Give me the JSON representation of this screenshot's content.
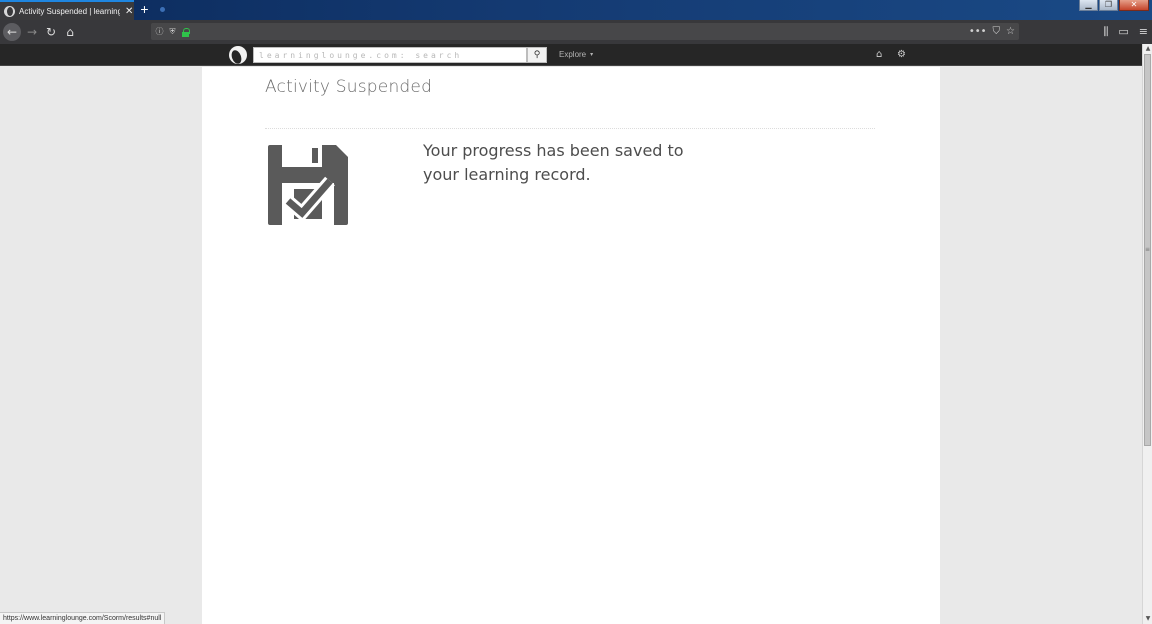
{
  "browser": {
    "tab_title": "Activity Suspended | learninglo",
    "tab_close": "✕",
    "new_tab": "+",
    "window_controls": {
      "minimize": "▁",
      "maximize": "❐",
      "close": "✕"
    },
    "toolbar_icons": {
      "back": "arrow-left-icon",
      "forward": "arrow-right-icon",
      "reload": "reload-icon",
      "home": "home-icon",
      "page_actions": "ellipsis-icon",
      "pocket": "pocket-icon",
      "bookmark": "star-icon",
      "library": "library-icon",
      "sidebar": "sidebar-icon",
      "menu": "hamburger-icon"
    },
    "glyphs": {
      "back": "←",
      "forward": "→",
      "reload": "↻",
      "home": "⌂",
      "info": "ⓘ",
      "shield": "⛨",
      "page_actions": "•••",
      "pocket": "⛉",
      "bookmark": "☆",
      "library": "⫼",
      "sidebar": "▭",
      "menu": "≡"
    },
    "status_url": "https://www.learninglounge.com/Scorm/results#null"
  },
  "site_nav": {
    "search_placeholder": "learninglounge.com: search",
    "search_icon": "⚲",
    "explore_label": "Explore",
    "explore_caret": "▾",
    "home_glyph": "⌂",
    "settings_glyph": "⚙"
  },
  "page": {
    "title": "Activity Suspended",
    "message": "Your progress has been saved to your learning record.",
    "icon_color": "#5a5a5a"
  },
  "scrollbar": {
    "grip": "≡",
    "up": "▲",
    "down": "▼"
  }
}
